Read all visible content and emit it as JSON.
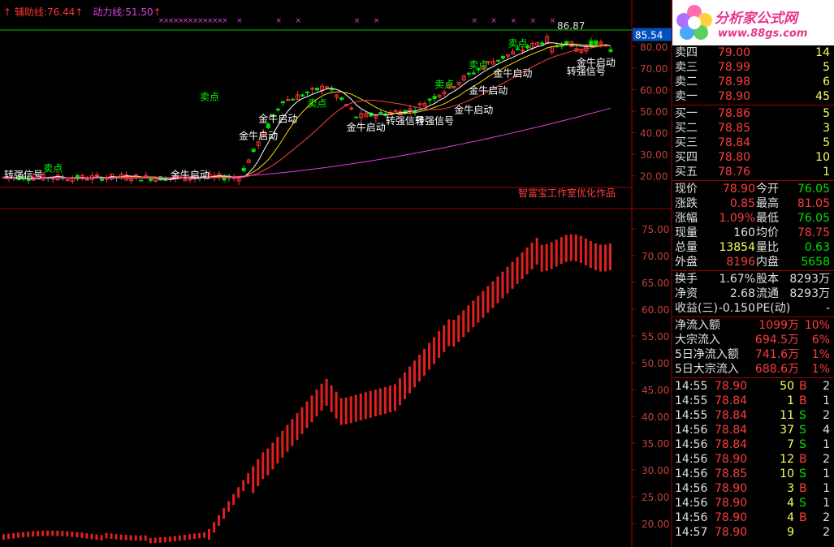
{
  "colors": {
    "up": "#ff3232",
    "down": "#00e000",
    "grid": "#a00000",
    "ma5": "#ffffff",
    "ma10": "#ffd700",
    "ma30": "#ff4040",
    "ma60": "#e040e0",
    "accent": "#e8348c"
  },
  "legend": {
    "aux_label": "辅助线:",
    "aux_value": "76.44",
    "power_label": "动力线:",
    "power_value": "51.50"
  },
  "main_chart": {
    "ylim": [
      15,
      88
    ],
    "ticks": [
      "80.00",
      "70.00",
      "60.00",
      "50.00",
      "40.00",
      "30.00",
      "20.00"
    ],
    "current_price_tag": "85.54",
    "high_marker": "86.87",
    "credit": "智富宝工作室优化作品",
    "signals": [
      {
        "text": "卖点",
        "i": 40,
        "v": 55,
        "color": "#00ff00"
      },
      {
        "text": "金牛启动",
        "i": 48,
        "v": 37,
        "color": "#ffffff"
      },
      {
        "text": "金牛启动",
        "i": 52,
        "v": 45,
        "color": "#ffffff"
      },
      {
        "text": "卖点",
        "i": 62,
        "v": 52,
        "color": "#00ff00"
      },
      {
        "text": "金牛启动",
        "i": 70,
        "v": 41,
        "color": "#ffffff"
      },
      {
        "text": "转强信号",
        "i": 78,
        "v": 44,
        "color": "#ffffff"
      },
      {
        "text": "转强信号",
        "i": 84,
        "v": 44,
        "color": "#ffffff"
      },
      {
        "text": "卖点",
        "i": 88,
        "v": 61,
        "color": "#00ff00"
      },
      {
        "text": "金牛启动",
        "i": 92,
        "v": 49,
        "color": "#ffffff"
      },
      {
        "text": "金牛启动",
        "i": 95,
        "v": 58,
        "color": "#ffffff"
      },
      {
        "text": "卖点",
        "i": 95,
        "v": 70,
        "color": "#00ff00"
      },
      {
        "text": "金牛启动",
        "i": 100,
        "v": 66,
        "color": "#ffffff"
      },
      {
        "text": "卖点",
        "i": 103,
        "v": 80,
        "color": "#00ff00"
      },
      {
        "text": "金牛启动",
        "i": 117,
        "v": 71,
        "color": "#ffffff"
      },
      {
        "text": "转强信号",
        "i": 115,
        "v": 67,
        "color": "#ffffff"
      },
      {
        "text": "转强信号",
        "i": 0,
        "v": 19,
        "color": "#ffffff"
      },
      {
        "text": "卖点",
        "i": 8,
        "v": 22,
        "color": "#00ff00"
      },
      {
        "text": "金牛启动",
        "i": 34,
        "v": 19,
        "color": "#ffffff"
      }
    ]
  },
  "sub_chart": {
    "ylim": [
      17,
      78
    ],
    "ticks": [
      "75.00",
      "70.00",
      "65.00",
      "60.00",
      "55.00",
      "50.00",
      "45.00",
      "40.00",
      "35.00",
      "30.00",
      "25.00",
      "20.00"
    ]
  },
  "quote": {
    "logo_title": "分析家公式网",
    "logo_url": "www.88gs.com",
    "asks": [
      {
        "label": "卖四",
        "price": "79.00",
        "vol": "14"
      },
      {
        "label": "卖三",
        "price": "78.99",
        "vol": "5"
      },
      {
        "label": "卖二",
        "price": "78.98",
        "vol": "6"
      },
      {
        "label": "卖一",
        "price": "78.90",
        "vol": "45"
      }
    ],
    "bids": [
      {
        "label": "买一",
        "price": "78.86",
        "vol": "5"
      },
      {
        "label": "买二",
        "price": "78.85",
        "vol": "3"
      },
      {
        "label": "买三",
        "price": "78.84",
        "vol": "5"
      },
      {
        "label": "买四",
        "price": "78.80",
        "vol": "10"
      },
      {
        "label": "买五",
        "price": "78.76",
        "vol": "1"
      }
    ],
    "stats": [
      {
        "l1": "现价",
        "v1": "78.90",
        "c1": "red",
        "l2": "今开",
        "v2": "76.05",
        "c2": "grn"
      },
      {
        "l1": "涨跌",
        "v1": "0.85",
        "c1": "red",
        "l2": "最高",
        "v2": "81.05",
        "c2": "red"
      },
      {
        "l1": "涨幅",
        "v1": "1.09%",
        "c1": "red",
        "l2": "最低",
        "v2": "76.05",
        "c2": "grn"
      },
      {
        "l1": "现量",
        "v1": "160",
        "c1": "wht",
        "l2": "均价",
        "v2": "78.75",
        "c2": "red"
      },
      {
        "l1": "总量",
        "v1": "13854",
        "c1": "yel",
        "l2": "量比",
        "v2": "0.63",
        "c2": "grn"
      },
      {
        "l1": "外盘",
        "v1": "8196",
        "c1": "red",
        "l2": "内盘",
        "v2": "5658",
        "c2": "grn"
      }
    ],
    "stats2": [
      {
        "l1": "换手",
        "v1": "1.67%",
        "l2": "股本",
        "v2": "8293万"
      },
      {
        "l1": "净资",
        "v1": "2.68",
        "l2": "流通",
        "v2": "8293万"
      },
      {
        "l1": "收益(三)",
        "v1": "-0.150",
        "l2": "PE(动)",
        "v2": "-"
      }
    ],
    "flows": [
      {
        "label": "净流入额",
        "value": "1099万",
        "pct": "10%"
      },
      {
        "label": "大宗流入",
        "value": "694.5万",
        "pct": "6%"
      },
      {
        "label": "5日净流入额",
        "value": "741.6万",
        "pct": "1%"
      },
      {
        "label": "5日大宗流入",
        "value": "688.6万",
        "pct": "1%"
      }
    ],
    "ticks": [
      {
        "time": "14:55",
        "price": "78.90",
        "vol": "50",
        "side": "B",
        "n": "2"
      },
      {
        "time": "14:55",
        "price": "78.84",
        "vol": "1",
        "side": "B",
        "n": "1"
      },
      {
        "time": "14:55",
        "price": "78.84",
        "vol": "11",
        "side": "S",
        "n": "2"
      },
      {
        "time": "14:56",
        "price": "78.84",
        "vol": "37",
        "side": "S",
        "n": "4"
      },
      {
        "time": "14:56",
        "price": "78.84",
        "vol": "7",
        "side": "S",
        "n": "1"
      },
      {
        "time": "14:56",
        "price": "78.90",
        "vol": "12",
        "side": "B",
        "n": "2"
      },
      {
        "time": "14:56",
        "price": "78.85",
        "vol": "10",
        "side": "S",
        "n": "1"
      },
      {
        "time": "14:56",
        "price": "78.90",
        "vol": "3",
        "side": "B",
        "n": "1"
      },
      {
        "time": "14:56",
        "price": "78.90",
        "vol": "4",
        "side": "S",
        "n": "1"
      },
      {
        "time": "14:56",
        "price": "78.90",
        "vol": "4",
        "side": "B",
        "n": "2"
      },
      {
        "time": "14:57",
        "price": "78.90",
        "vol": "9",
        "side": "",
        "n": "2"
      }
    ]
  }
}
